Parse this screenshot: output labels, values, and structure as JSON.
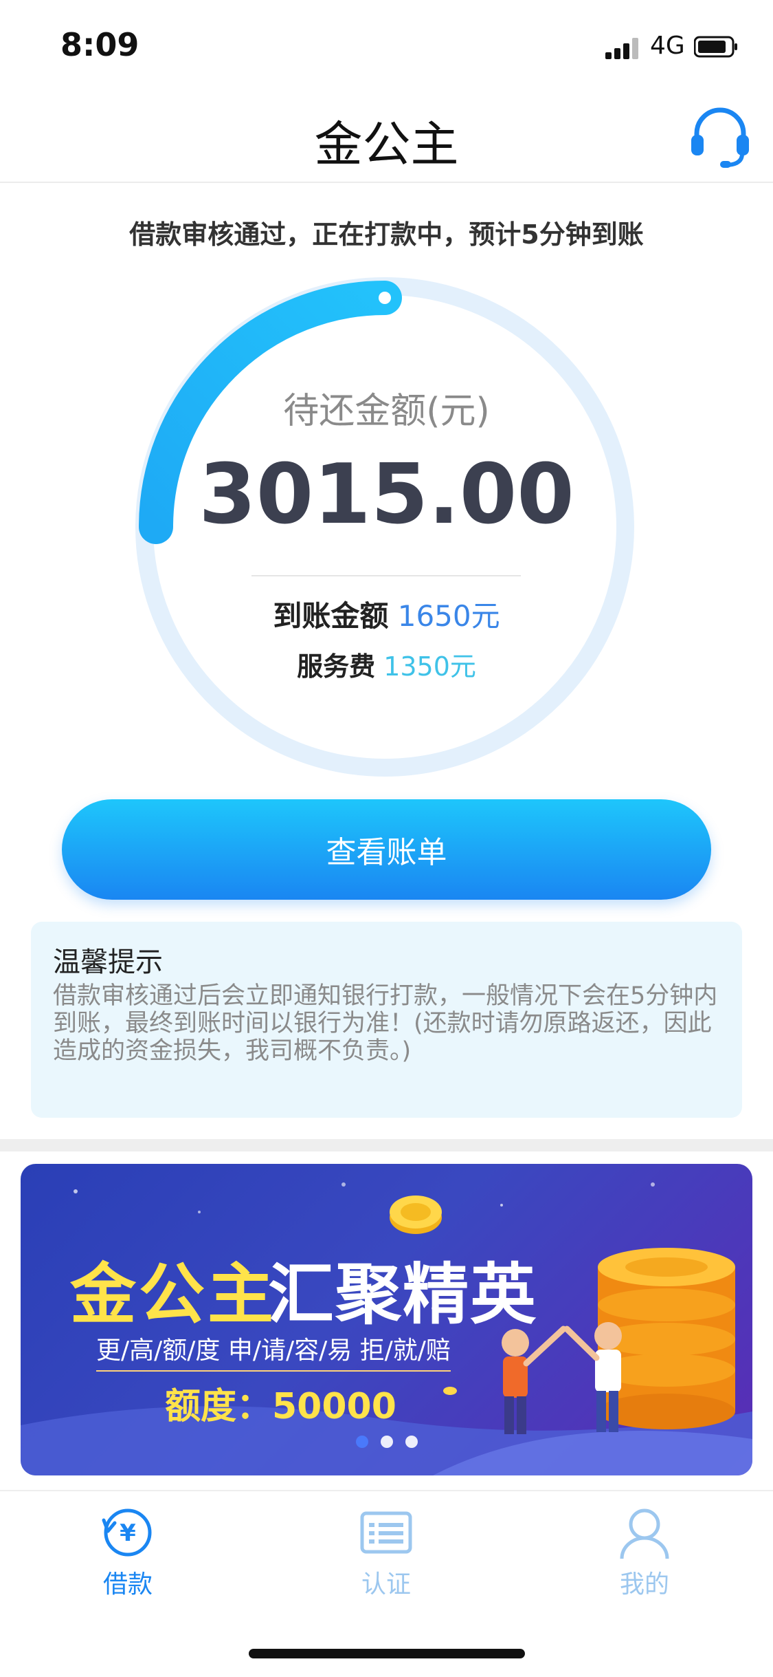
{
  "status_bar": {
    "time": "8:09",
    "network": "4G"
  },
  "header": {
    "title": "金公主",
    "support_icon": "headset-icon"
  },
  "notice": "借款审核通过，正在打款中，预计5分钟到账",
  "summary": {
    "label": "待还金额(元)",
    "amount": "3015.00",
    "received_label": "到账金额",
    "received_value": "1650元",
    "fee_label": "服务费",
    "fee_value": "1350元"
  },
  "view_bill_button": "查看账单",
  "tips": {
    "title": "温馨提示",
    "body": "借款审核通过后会立即通知银行打款，一般情况下会在5分钟内到账，最终到账时间以银行为准！(还款时请勿原路返还，因此造成的资金损失，我司概不负责。)"
  },
  "banner": {
    "title_left": "金公主",
    "title_right": "汇聚精英",
    "subtitle": "更/高/额/度  申/请/容/易  拒/就/赔",
    "quota": "额度：50000"
  },
  "tabs": [
    {
      "label": "借款",
      "icon": "loan-icon",
      "active": true
    },
    {
      "label": "认证",
      "icon": "id-card-icon",
      "active": false
    },
    {
      "label": "我的",
      "icon": "user-icon",
      "active": false
    }
  ],
  "colors": {
    "accent": "#1a86f2",
    "received": "#3a86e8",
    "fee": "#3fc2e8",
    "inactive_tab": "#9cc7ef"
  }
}
